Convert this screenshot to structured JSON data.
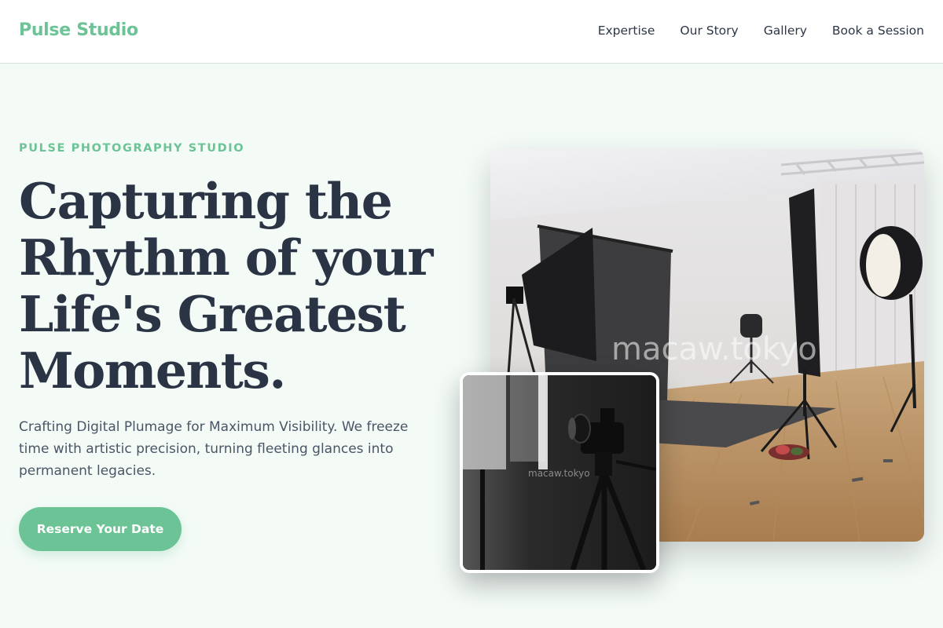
{
  "header": {
    "logo": "Pulse Studio",
    "nav": [
      {
        "label": "Expertise"
      },
      {
        "label": "Our Story"
      },
      {
        "label": "Gallery"
      },
      {
        "label": "Book a Session"
      }
    ]
  },
  "hero": {
    "eyebrow": "PULSE PHOTOGRAPHY STUDIO",
    "headline": "Capturing the Rhythm of your Life's Greatest Moments.",
    "subtext": "Crafting Digital Plumage for Maximum Visibility. We freeze time with artistic precision, turning fleeting glances into permanent legacies.",
    "cta_label": "Reserve Your Date"
  },
  "images": {
    "main": {
      "subject": "studio-interior-photo",
      "watermark": "macaw.tokyo"
    },
    "secondary": {
      "subject": "camera-on-tripod-photo",
      "watermark": "macaw.tokyo"
    }
  },
  "colors": {
    "accent": "#6cc396",
    "headline": "#2a3445",
    "background": "#f4fbf7"
  }
}
